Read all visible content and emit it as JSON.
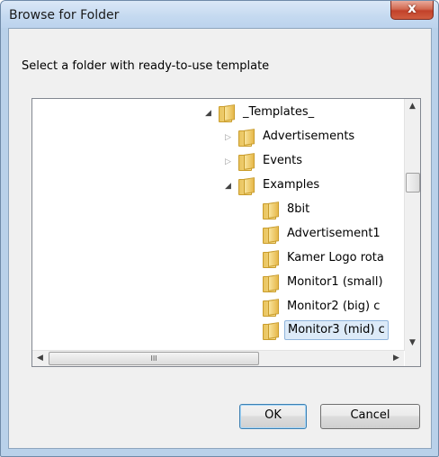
{
  "window": {
    "title": "Browse for Folder",
    "close_glyph": "x"
  },
  "dialog": {
    "instructions": "Select a folder with ready-to-use template"
  },
  "tree": {
    "items": [
      {
        "label": "_Templates_",
        "state": "expanded"
      },
      {
        "label": "Advertisements",
        "state": "collapsed"
      },
      {
        "label": "Events",
        "state": "collapsed"
      },
      {
        "label": "Examples",
        "state": "expanded"
      },
      {
        "label": "8bit",
        "state": "leaf"
      },
      {
        "label": "Advertisement1",
        "state": "leaf"
      },
      {
        "label": "Kamer Logo rota",
        "state": "leaf"
      },
      {
        "label": "Monitor1 (small)",
        "state": "leaf"
      },
      {
        "label": "Monitor2 (big) c",
        "state": "leaf"
      },
      {
        "label": "Monitor3 (mid) c",
        "state": "leaf",
        "selected": true
      }
    ],
    "scroll_thumb_grip": "III"
  },
  "buttons": {
    "ok": "OK",
    "cancel": "Cancel"
  }
}
